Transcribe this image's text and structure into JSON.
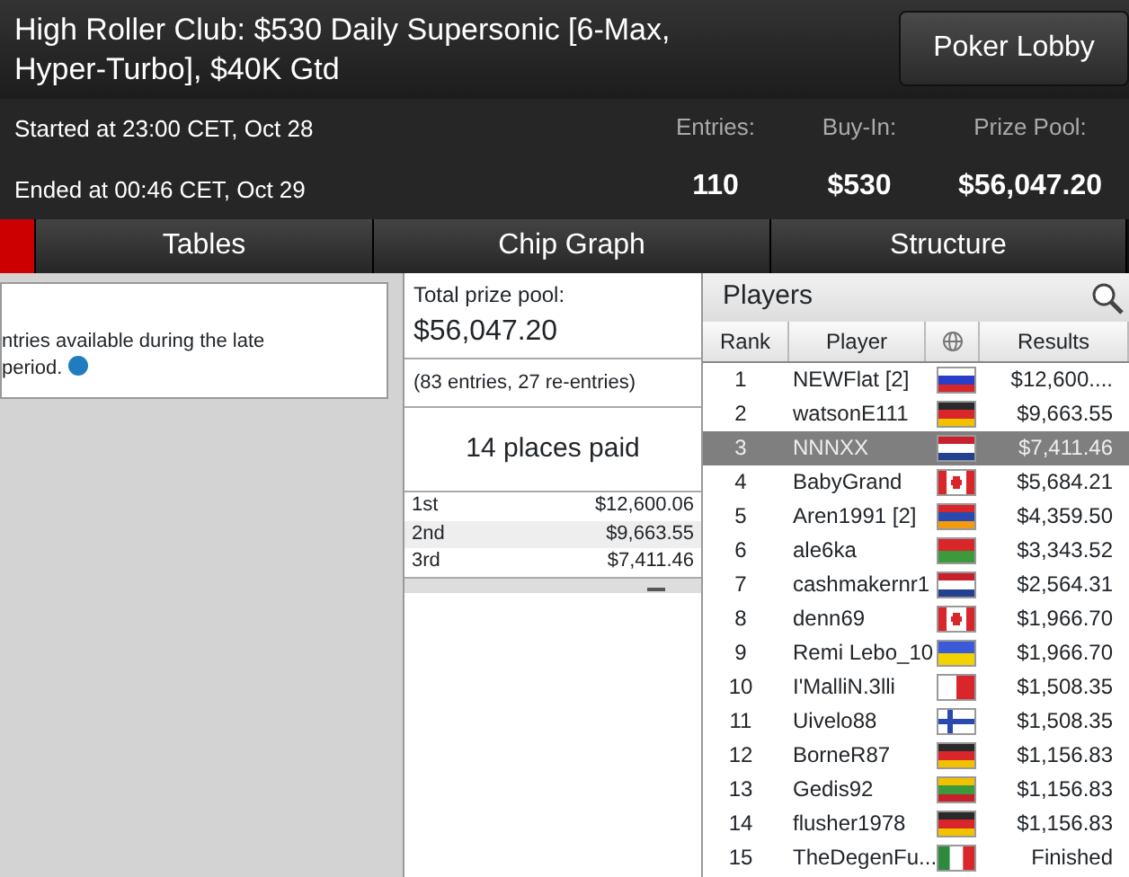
{
  "header": {
    "title": "High Roller Club: $530 Daily Supersonic [6-Max, Hyper-Turbo], $40K Gtd",
    "lobby_button": "Poker Lobby",
    "started": "Started at 23:00 CET, Oct 28",
    "ended": "Ended at 00:46 CET, Oct 29",
    "stats": [
      {
        "label": "Entries:",
        "value": "110"
      },
      {
        "label": "Buy-In:",
        "value": "$530"
      },
      {
        "label": "Prize Pool:",
        "value": "$56,047.20"
      }
    ]
  },
  "tabs": [
    {
      "selected": true
    },
    {
      "label": "Tables",
      "selected": false
    },
    {
      "label": "Chip Graph",
      "selected": false
    },
    {
      "label": "Structure",
      "selected": false
    }
  ],
  "info": {
    "lines": [
      "ntries available during the late",
      "period."
    ]
  },
  "prizes": {
    "total_label": "Total prize pool:",
    "total": "$56,047.20",
    "entries": "(83 entries, 27 re-entries)",
    "places": "14 places paid",
    "rows": [
      {
        "place": "1st",
        "amount": "$12,600.06"
      },
      {
        "place": "2nd",
        "amount": "$9,663.55"
      },
      {
        "place": "3rd",
        "amount": "$7,411.46"
      }
    ]
  },
  "players": {
    "title": "Players",
    "columns": [
      "Rank",
      "Player",
      "Results"
    ],
    "rows": [
      {
        "rank": "1",
        "name": "NEWFlat [2]",
        "result": "$12,600....",
        "selected": false,
        "flag": {
          "kind": "stripes",
          "stripes": [
            {
              "color": "#ffffff"
            },
            {
              "color": "#2a3fc8"
            },
            {
              "color": "#d8262b"
            }
          ]
        }
      },
      {
        "rank": "2",
        "name": "watsonE111",
        "result": "$9,663.55",
        "selected": false,
        "flag": {
          "kind": "stripes",
          "stripes": [
            {
              "color": "#2a2a2a"
            },
            {
              "color": "#d8262b"
            },
            {
              "color": "#f2c200"
            }
          ]
        }
      },
      {
        "rank": "3",
        "name": "NNNXX",
        "result": "$7,411.46",
        "selected": true,
        "flag": {
          "kind": "stripes",
          "stripes": [
            {
              "color": "#c8202c"
            },
            {
              "color": "#ffffff"
            },
            {
              "color": "#24418f"
            }
          ]
        }
      },
      {
        "rank": "4",
        "name": "BabyGrand",
        "result": "$5,684.21",
        "selected": false,
        "flag": {
          "kind": "leaf",
          "stripes": [
            {
              "color": "#d8262b"
            },
            {
              "color": "#ffffff"
            }
          ]
        }
      },
      {
        "rank": "5",
        "name": "Aren1991 [2]",
        "result": "$4,359.50",
        "selected": false,
        "flag": {
          "kind": "stripes",
          "stripes": [
            {
              "color": "#d8262b"
            },
            {
              "color": "#2a4ab0"
            },
            {
              "color": "#f29a10"
            }
          ]
        }
      },
      {
        "rank": "6",
        "name": "ale6ka",
        "result": "$3,343.52",
        "selected": false,
        "flag": {
          "kind": "stripes",
          "stripes": [
            {
              "color": "#d8262b"
            },
            {
              "color": "#3c9a3c"
            }
          ]
        }
      },
      {
        "rank": "7",
        "name": "cashmakernr1",
        "result": "$2,564.31",
        "selected": false,
        "flag": {
          "kind": "stripes",
          "stripes": [
            {
              "color": "#c8202c"
            },
            {
              "color": "#ffffff"
            },
            {
              "color": "#24418f"
            }
          ]
        }
      },
      {
        "rank": "8",
        "name": "denn69",
        "result": "$1,966.70",
        "selected": false,
        "flag": {
          "kind": "leaf",
          "stripes": [
            {
              "color": "#d8262b"
            },
            {
              "color": "#ffffff"
            }
          ]
        }
      },
      {
        "rank": "9",
        "name": "Remi Lebo_10",
        "result": "$1,966.70",
        "selected": false,
        "flag": {
          "kind": "stripes",
          "stripes": [
            {
              "color": "#3a5ad8"
            },
            {
              "color": "#f2d200"
            }
          ]
        }
      },
      {
        "rank": "10",
        "name": "I'MalliN.3lli",
        "result": "$1,508.35",
        "selected": false,
        "flag": {
          "kind": "vstripes",
          "stripes": [
            {
              "color": "#ffffff"
            },
            {
              "color": "#d8262b"
            }
          ]
        }
      },
      {
        "rank": "11",
        "name": "Uivelo88",
        "result": "$1,508.35",
        "selected": false,
        "flag": {
          "kind": "cross",
          "stripes": [
            {
              "color": "#ffffff"
            },
            {
              "color": "#2a4ab0"
            }
          ]
        }
      },
      {
        "rank": "12",
        "name": "BorneR87",
        "result": "$1,156.83",
        "selected": false,
        "flag": {
          "kind": "stripes",
          "stripes": [
            {
              "color": "#2a2a2a"
            },
            {
              "color": "#d8262b"
            },
            {
              "color": "#f2c200"
            }
          ]
        }
      },
      {
        "rank": "13",
        "name": "Gedis92",
        "result": "$1,156.83",
        "selected": false,
        "flag": {
          "kind": "stripes",
          "stripes": [
            {
              "color": "#f2c200"
            },
            {
              "color": "#3c9a3c"
            },
            {
              "color": "#c8202c"
            }
          ]
        }
      },
      {
        "rank": "14",
        "name": "flusher1978",
        "result": "$1,156.83",
        "selected": false,
        "flag": {
          "kind": "stripes",
          "stripes": [
            {
              "color": "#2a2a2a"
            },
            {
              "color": "#d8262b"
            },
            {
              "color": "#f2c200"
            }
          ]
        }
      },
      {
        "rank": "15",
        "name": "TheDegenFu...",
        "result": "Finished",
        "selected": false,
        "flag": {
          "kind": "vstripes",
          "stripes": [
            {
              "color": "#2d8a3e"
            },
            {
              "color": "#ffffff"
            },
            {
              "color": "#d8262b"
            }
          ]
        }
      }
    ]
  }
}
